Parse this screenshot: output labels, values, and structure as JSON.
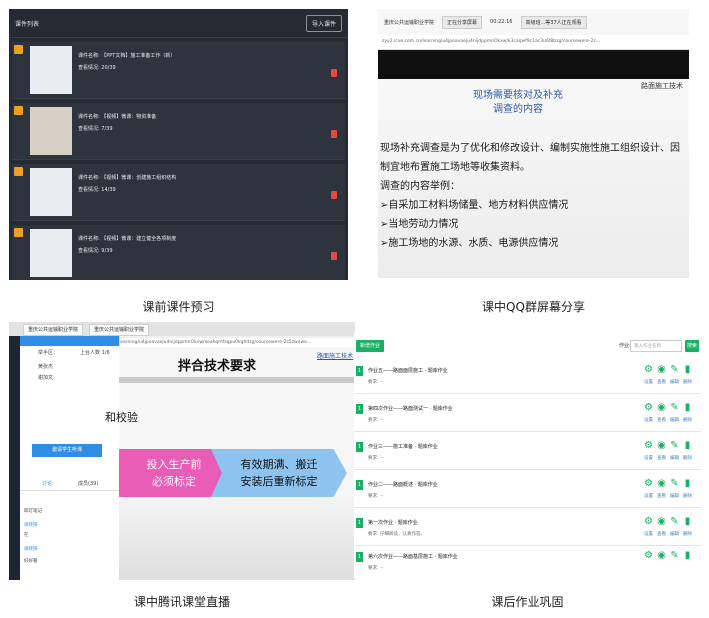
{
  "panel1": {
    "header_title": "课件列表",
    "upload_button": "导入课件",
    "items": [
      {
        "name": "课件名称: 【PPT文档】施工准备工作（新）",
        "progress": "查看情况: 20/39"
      },
      {
        "name": "课件名称: 【视频】微课：物资准备",
        "progress": "查看情况: 7/39"
      },
      {
        "name": "课件名称: 【视频】微课：创建施工组织结构",
        "progress": "查看情况: 14/39"
      },
      {
        "name": "课件名称: 【视频】微课：建立健全各项制度",
        "progress": "查看情况: 9/39"
      }
    ],
    "caption": "课前课件预习"
  },
  "panel2": {
    "top_title": "重庆公共运输职业学院",
    "status_pill": "正在分享屏幕",
    "timer": "00:22:16",
    "room": "高级班...等37人正在观看",
    "url": "zyy2.icve.com.cn/learning/u4jpoavaeju4nijdppmnOkxw/k3caqwf9c1ac3u6f8bzg/coursewere-2z...",
    "slide_title_line1": "现场需要核对及补充",
    "slide_title_line2": "调查的内容",
    "slide_tag": "路面施工技术",
    "body_line1": "现场补充调查是为了优化和修改设计、编制实施性施工组织设计、因",
    "body_line2": "制宜地布置施工场地等收集资料。",
    "body_line3": "调查的内容举例：",
    "bullet1": "➢自采加工材料场储量、地方材料供应情况",
    "bullet2": "➢当地劳动力情况",
    "bullet3": "➢施工场地的水源、水质、电源供应情况",
    "caption": "课中QQ群屏幕分享"
  },
  "panel3": {
    "tab1": "重庆公共运输职业学院",
    "tab2": "重庆公共运输职业学院",
    "url": "learning/u4jpoavaeju4nijdppmnOkxw/xeahqmfzqpu0kghdzg/coursewere-2z5zwawe...",
    "school_label": "举手区：",
    "online_label": "上台人数 1/6",
    "student1": "黄张杰",
    "student2": "谢加文",
    "start_button": "邀请学生听课",
    "tab_discuss": "讨论",
    "tab_members": "成员(39)",
    "chat": [
      "邱灯笔记",
      "谢晓阳",
      "在",
      "谢晓阳",
      "好好看"
    ],
    "slide_title": "拌合技术要求",
    "slide_tag": "路面施工技术",
    "line1": "和校验",
    "pink_l1": "投入生产前",
    "pink_l2": "必须标定",
    "blue_l1": "有效期满、搬迁",
    "blue_l2": "安装后重新标定",
    "caption": "课中腾讯课堂直播"
  },
  "panel4": {
    "new_button": "新增作业",
    "search_label": "作业:",
    "search_placeholder": "输入作业名称",
    "search_button": "搜索",
    "rows": [
      {
        "num": "1",
        "name": "作业五——路面面层施工 · 题库作业",
        "req": "要求: --"
      },
      {
        "num": "1",
        "name": "第四次作业——路面测试一 · 题库作业",
        "req": "要求: --"
      },
      {
        "num": "1",
        "name": "作业三——施工准备 · 题库作业",
        "req": "要求: --"
      },
      {
        "num": "1",
        "name": "作业二——路面概述 · 题库作业",
        "req": "要求: --"
      },
      {
        "num": "1",
        "name": "第一次作业 · 题库作业",
        "req": "要求: 仔细阅读，认真作答。"
      },
      {
        "num": "1",
        "name": "第六次作业——路面基层施工 · 题库作业",
        "req": "要求: --"
      }
    ],
    "action_labels": [
      "设置",
      "查看",
      "编辑",
      "删除"
    ],
    "caption": "课后作业巩固"
  }
}
